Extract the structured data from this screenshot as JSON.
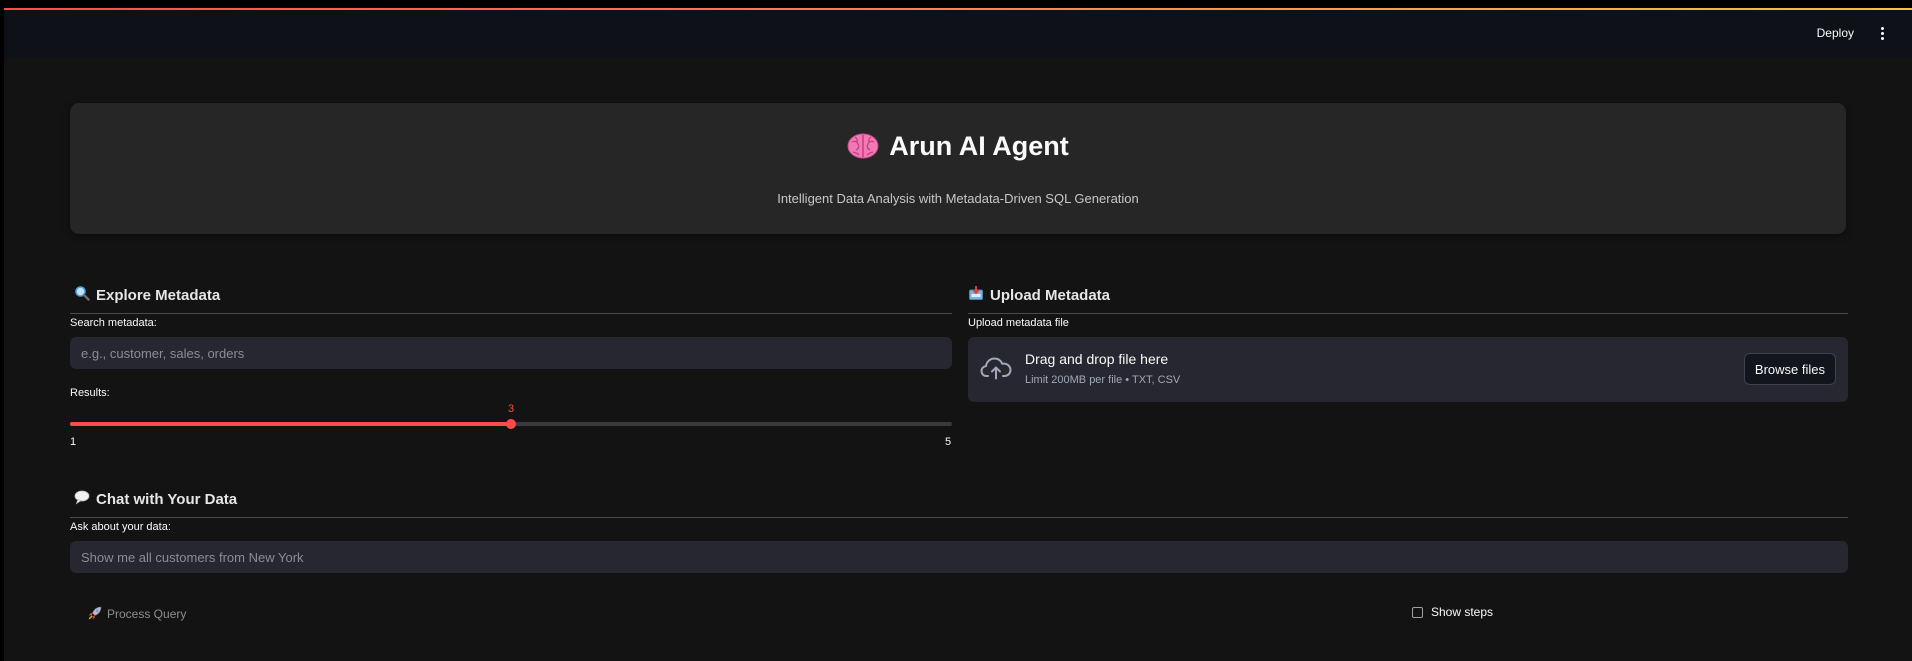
{
  "header": {
    "deploy_label": "Deploy",
    "menu_icon": "vertical-ellipsis-icon"
  },
  "hero": {
    "icon": "brain-icon",
    "title": "Arun AI Agent",
    "subtitle": "Intelligent Data Analysis with Metadata-Driven SQL Generation"
  },
  "explore": {
    "icon": "magnifier-icon",
    "title": "Explore Metadata",
    "search_label": "Search metadata:",
    "search_placeholder": "e.g., customer, sales, orders",
    "search_value": "",
    "results_label": "Results:",
    "slider": {
      "min": 1,
      "max": 5,
      "value": 3,
      "min_label": "1",
      "max_label": "5",
      "value_label": "3"
    }
  },
  "upload": {
    "icon": "inbox-tray-icon",
    "title": "Upload Metadata",
    "file_label": "Upload metadata file",
    "dropzone_title": "Drag and drop file here",
    "dropzone_sub": "Limit 200MB per file • TXT, CSV",
    "browse_label": "Browse files"
  },
  "chat": {
    "icon": "speech-bubble-icon",
    "title": "Chat with Your Data",
    "ask_label": "Ask about your data:",
    "ask_placeholder": "Show me all customers from New York",
    "ask_value": "",
    "process_icon": "rocket-icon",
    "process_label": "Process Query",
    "show_steps_label": "Show steps",
    "show_steps_checked": false
  },
  "colors": {
    "accent": "#ff4b4b",
    "background": "#131313",
    "card": "#262626",
    "input": "#262730"
  }
}
